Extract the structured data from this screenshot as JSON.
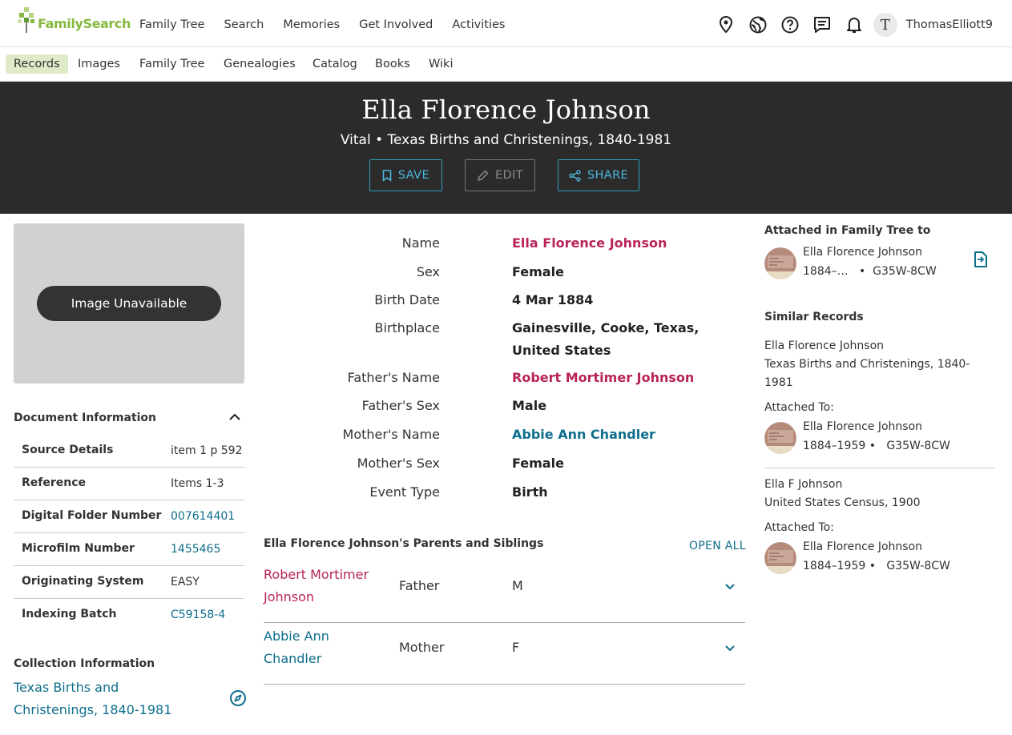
{
  "colors": {
    "brand_green": "#87b940",
    "hero_bg": "#2b2b2b",
    "link_blue": "#0f6e8c",
    "person_red": "#b8235a",
    "active_tab_bg": "#dfeac9"
  },
  "header": {
    "logo_text": "FamilySearch",
    "menu": [
      "Family Tree",
      "Search",
      "Memories",
      "Get Involved",
      "Activities"
    ],
    "icons": [
      "location-pin-icon",
      "globe-icon",
      "help-icon",
      "messages-icon",
      "bell-icon"
    ],
    "avatar_initial": "T",
    "username": "ThomasElliott9"
  },
  "subnav": {
    "items": [
      "Records",
      "Images",
      "Family Tree",
      "Genealogies",
      "Catalog",
      "Books",
      "Wiki"
    ],
    "active": "Records"
  },
  "hero": {
    "title": "Ella Florence Johnson",
    "subtitle": "Vital • Texas Births and Christenings, 1840-1981",
    "save_label": "SAVE",
    "edit_label": "EDIT",
    "share_label": "SHARE"
  },
  "image_panel": {
    "label": "Image Unavailable"
  },
  "document": {
    "heading": "Document Information",
    "rows": [
      {
        "key": "Source Details",
        "value": "item 1 p 592"
      },
      {
        "key": "Reference",
        "value": "Items 1-3"
      },
      {
        "key": "Digital Folder Number",
        "value": "007614401"
      },
      {
        "key": "Microfilm Number",
        "value": "1455465"
      },
      {
        "key": "Originating System",
        "value": "EASY"
      },
      {
        "key": "Indexing Batch",
        "value": "C59158-4"
      }
    ]
  },
  "collection": {
    "heading": "Collection Information",
    "link": "Texas Births and Christenings, 1840-1981"
  },
  "facts": [
    {
      "label": "Name",
      "value": "Ella Florence Johnson"
    },
    {
      "label": "Sex",
      "value": "Female"
    },
    {
      "label": "Birth Date",
      "value": "4 Mar 1884"
    },
    {
      "label": "Birthplace",
      "value": "Gainesville, Cooke, Texas, United States"
    },
    {
      "label": "Father's Name",
      "value": "Robert Mortimer Johnson"
    },
    {
      "label": "Father's Sex",
      "value": "Male"
    },
    {
      "label": "Mother's Name",
      "value": "Abbie Ann Chandler"
    },
    {
      "label": "Mother's Sex",
      "value": "Female"
    },
    {
      "label": "Event Type",
      "value": "Birth"
    }
  ],
  "parents_siblings": {
    "heading": "Ella Florence Johnson's Parents and Siblings",
    "open_all": "OPEN ALL",
    "rows": [
      {
        "name": "Robert Mortimer Johnson",
        "relation": "Father",
        "sex": "M"
      },
      {
        "name": "Abbie Ann Chandler",
        "relation": "Mother",
        "sex": "F"
      }
    ]
  },
  "attached": {
    "heading": "Attached in Family Tree to",
    "name": "Ella Florence Johnson",
    "dates": "1884–…",
    "pid": "G35W-8CW"
  },
  "similar": {
    "heading": "Similar Records",
    "attached_label": "Attached To:",
    "records": [
      {
        "name": "Ella Florence Johnson",
        "collection": "Texas Births and Christenings, 1840-1981",
        "person": "Ella Florence Johnson",
        "dates": "1884–1959",
        "pid": "G35W-8CW"
      },
      {
        "name": "Ella F Johnson",
        "collection": "United States Census, 1900",
        "person": "Ella Florence Johnson",
        "dates": "1884–1959",
        "pid": "G35W-8CW"
      }
    ]
  }
}
